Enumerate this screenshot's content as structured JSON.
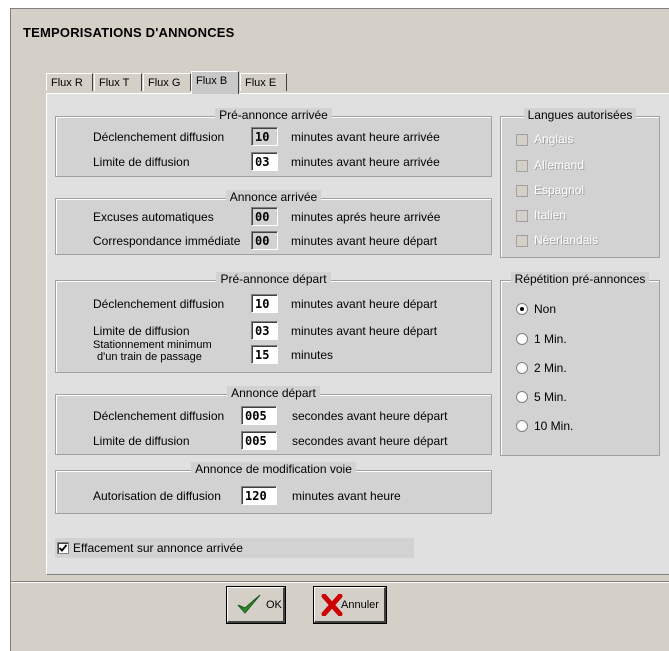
{
  "window": {
    "title": "TEMPORISATIONS D'ANNONCES"
  },
  "tabs": [
    {
      "label": "Flux R"
    },
    {
      "label": "Flux T"
    },
    {
      "label": "Flux G"
    },
    {
      "label": "Flux B"
    },
    {
      "label": "Flux E"
    }
  ],
  "active_tab": "Flux B",
  "pre_annonce_arrivee": {
    "title": "Pré-annonce arrivée",
    "rows": [
      {
        "label": "Déclenchement diffusion",
        "value": "10",
        "suffix": "minutes avant heure arrivée"
      },
      {
        "label": "Limite de diffusion",
        "value": "03",
        "suffix": "minutes avant heure arrivée"
      }
    ]
  },
  "annonce_arrivee": {
    "title": "Annonce arrivée",
    "rows": [
      {
        "label": "Excuses automatiques",
        "value": "00",
        "suffix": "minutes aprés heure arrivée"
      },
      {
        "label": "Correspondance immédiate",
        "value": "00",
        "suffix": "minutes avant heure départ"
      }
    ]
  },
  "pre_annonce_depart": {
    "title": "Pré-annonce départ",
    "rows": [
      {
        "label": "Déclenchement diffusion",
        "value": "10",
        "suffix": "minutes avant heure départ"
      },
      {
        "label": "Limite de diffusion",
        "value": "03",
        "suffix": "minutes avant heure départ"
      },
      {
        "label_line1": "Stationnement minimum",
        "label_line2": "d'un train de passage",
        "value": "15",
        "suffix": "minutes"
      }
    ]
  },
  "annonce_depart": {
    "title": "Annonce départ",
    "rows": [
      {
        "label": "Déclenchement diffusion",
        "value": "005",
        "suffix": "secondes avant heure départ"
      },
      {
        "label": "Limite de diffusion",
        "value": "005",
        "suffix": "secondes avant heure départ"
      }
    ]
  },
  "modification_voie": {
    "title": "Annonce de modification voie",
    "rows": [
      {
        "label": "Autorisation de diffusion",
        "value": "120",
        "suffix": "minutes avant heure"
      }
    ]
  },
  "langues": {
    "title": "Langues autorisées",
    "items": [
      "Anglais",
      "Allemand",
      "Espagnol",
      "Italien",
      "Néerlandais"
    ]
  },
  "repetition": {
    "title": "Répétition pré-annonces",
    "options": [
      "Non",
      "1 Min.",
      "2 Min.",
      "5 Min.",
      "10 Min."
    ],
    "selected": "Non"
  },
  "effacement": {
    "label": "Effacement sur annonce arrivée",
    "checked": true
  },
  "buttons": {
    "ok": "OK",
    "annuler": "Annuler"
  },
  "colors": {
    "ok_check": "#2e8b2e",
    "cancel_x": "#cc0000"
  }
}
